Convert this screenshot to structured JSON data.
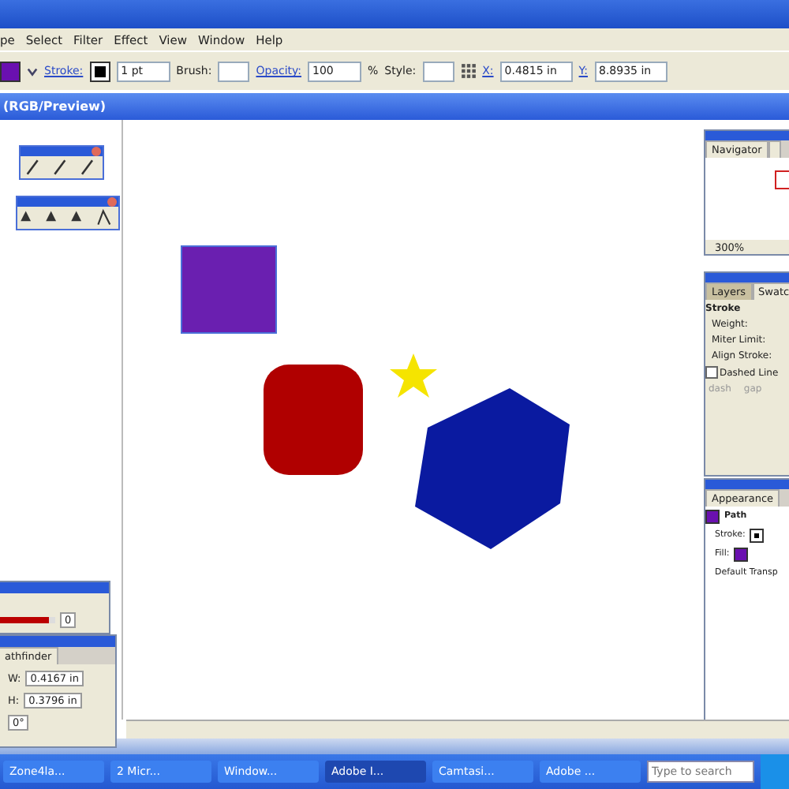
{
  "menu": [
    "pe",
    "Select",
    "Filter",
    "Effect",
    "View",
    "Window",
    "Help"
  ],
  "control_bar": {
    "stroke_label": "Stroke:",
    "weight": "1 pt",
    "brush_label": "Brush:",
    "opacity_label": "Opacity:",
    "opacity": "100",
    "percent": "%",
    "style_label": "Style:",
    "x_label": "X:",
    "x": "0.4815 in",
    "y_label": "Y:",
    "y": "8.8935 in"
  },
  "document": {
    "title": "(RGB/Preview)"
  },
  "navigator": {
    "tab": "Navigator",
    "zoom": "300%"
  },
  "stroke_panel": {
    "tabs": [
      {
        "label": "Layers",
        "selected": true
      },
      {
        "label": "Swatc",
        "selected": false
      }
    ],
    "title": "Stroke",
    "weight_label": "Weight:",
    "miter_label": "Miter Limit:",
    "align_label": "Align Stroke:",
    "dashed": {
      "label": "Dashed Line",
      "checked": false
    },
    "dash_labels": [
      "dash",
      "gap"
    ]
  },
  "appearance": {
    "tab": "Appearance",
    "item": "Path",
    "stroke_label": "Stroke:",
    "fill_label": "Fill:",
    "transparency": "Default Transp"
  },
  "color_panel": {
    "level": 0.9,
    "value": "0"
  },
  "transform_panel": {
    "tab": "athfinder",
    "w_label": "W:",
    "w": "0.4167 in",
    "h_label": "H:",
    "h": "0.3796 in",
    "angle": "0°"
  },
  "taskbar": {
    "items": [
      {
        "label": "Zone4la...",
        "selected": false
      },
      {
        "label": "2 Micr...",
        "selected": false
      },
      {
        "label": "Window...",
        "selected": false
      },
      {
        "label": "Adobe I...",
        "selected": true
      },
      {
        "label": "Camtasi...",
        "selected": false
      },
      {
        "label": "Adobe ...",
        "selected": false
      }
    ],
    "search": {
      "placeholder": "Type to search"
    }
  }
}
